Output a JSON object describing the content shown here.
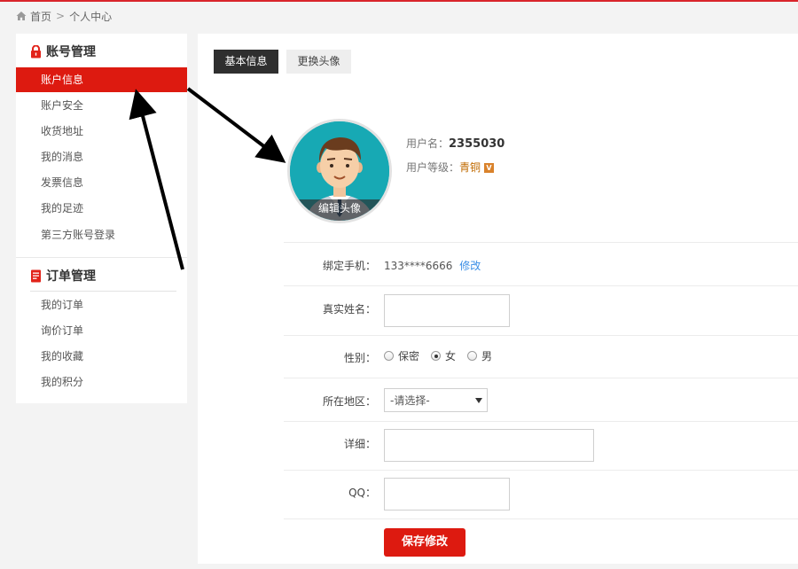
{
  "breadcrumb": {
    "home": "首页",
    "separator": ">",
    "current": "个人中心"
  },
  "sidebar": {
    "account_group": {
      "title": "账号管理",
      "items": [
        {
          "label": "账户信息",
          "active": true
        },
        {
          "label": "账户安全"
        },
        {
          "label": "收货地址"
        },
        {
          "label": "我的消息"
        },
        {
          "label": "发票信息"
        },
        {
          "label": "我的足迹"
        },
        {
          "label": "第三方账号登录"
        }
      ]
    },
    "order_group": {
      "title": "订单管理",
      "items": [
        {
          "label": "我的订单"
        },
        {
          "label": "询价订单"
        },
        {
          "label": "我的收藏"
        },
        {
          "label": "我的积分"
        }
      ]
    }
  },
  "tabs": {
    "basic": "基本信息",
    "avatar": "更换头像"
  },
  "profile": {
    "avatar_edit": "编辑头像",
    "username_label": "用户名：",
    "username": "2355030",
    "level_label": "用户等级：",
    "level": "青铜",
    "level_badge": "V"
  },
  "form": {
    "phone_label": "绑定手机：",
    "phone_value": "133****6666",
    "phone_edit": "修改",
    "realname_label": "真实姓名：",
    "realname_value": "",
    "gender_label": "性别：",
    "gender_options": [
      "保密",
      "女",
      "男"
    ],
    "gender_selected": "女",
    "region_label": "所在地区：",
    "region_value": "-请选择-",
    "detail_label": "详细：",
    "detail_value": "",
    "qq_label": "QQ：",
    "qq_value": "",
    "save_label": "保存修改"
  },
  "colors": {
    "accent": "#dd1a10",
    "dark_tab": "#2f2f2f",
    "link": "#3a8ee6",
    "avatar_bg": "#17a9b4"
  }
}
